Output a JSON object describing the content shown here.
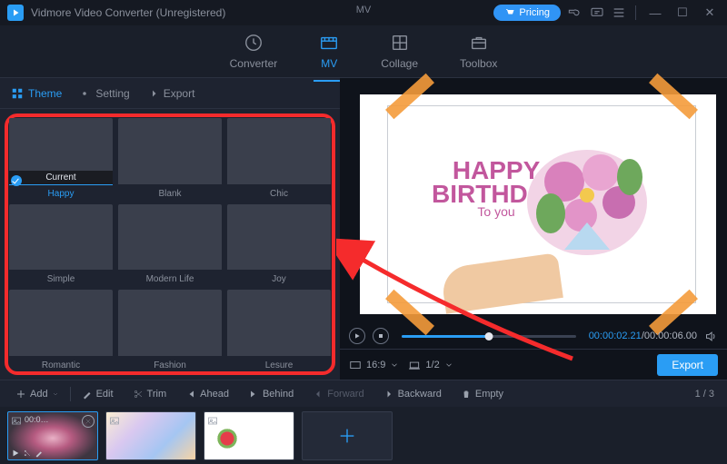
{
  "title": "Vidmore Video Converter (Unregistered)",
  "mv_label": "MV",
  "pricing": "Pricing",
  "main_tabs": {
    "converter": "Converter",
    "mv": "MV",
    "collage": "Collage",
    "toolbox": "Toolbox"
  },
  "left_tabs": {
    "theme": "Theme",
    "setting": "Setting",
    "export": "Export"
  },
  "themes": {
    "happy": "Happy",
    "blank": "Blank",
    "chic": "Chic",
    "simple": "Simple",
    "modern": "Modern Life",
    "joy": "Joy",
    "romantic": "Romantic",
    "fashion": "Fashion",
    "lesure": "Lesure",
    "current_tag": "Current"
  },
  "preview_text": {
    "line1": "HAPPY",
    "line2": "BIRTHDAY",
    "line3": "To you"
  },
  "player": {
    "time_current": "00:00:02.21",
    "sep": "/",
    "time_total": "00:00:06.00"
  },
  "ratio_bar": {
    "aspect": "16:9",
    "fit": "1/2",
    "export": "Export"
  },
  "toolbar": {
    "add": "Add",
    "edit": "Edit",
    "trim": "Trim",
    "ahead": "Ahead",
    "behind": "Behind",
    "forward": "Forward",
    "backward": "Backward",
    "empty": "Empty",
    "page": "1 / 3"
  },
  "clips": {
    "c1_time": "00:0…"
  }
}
